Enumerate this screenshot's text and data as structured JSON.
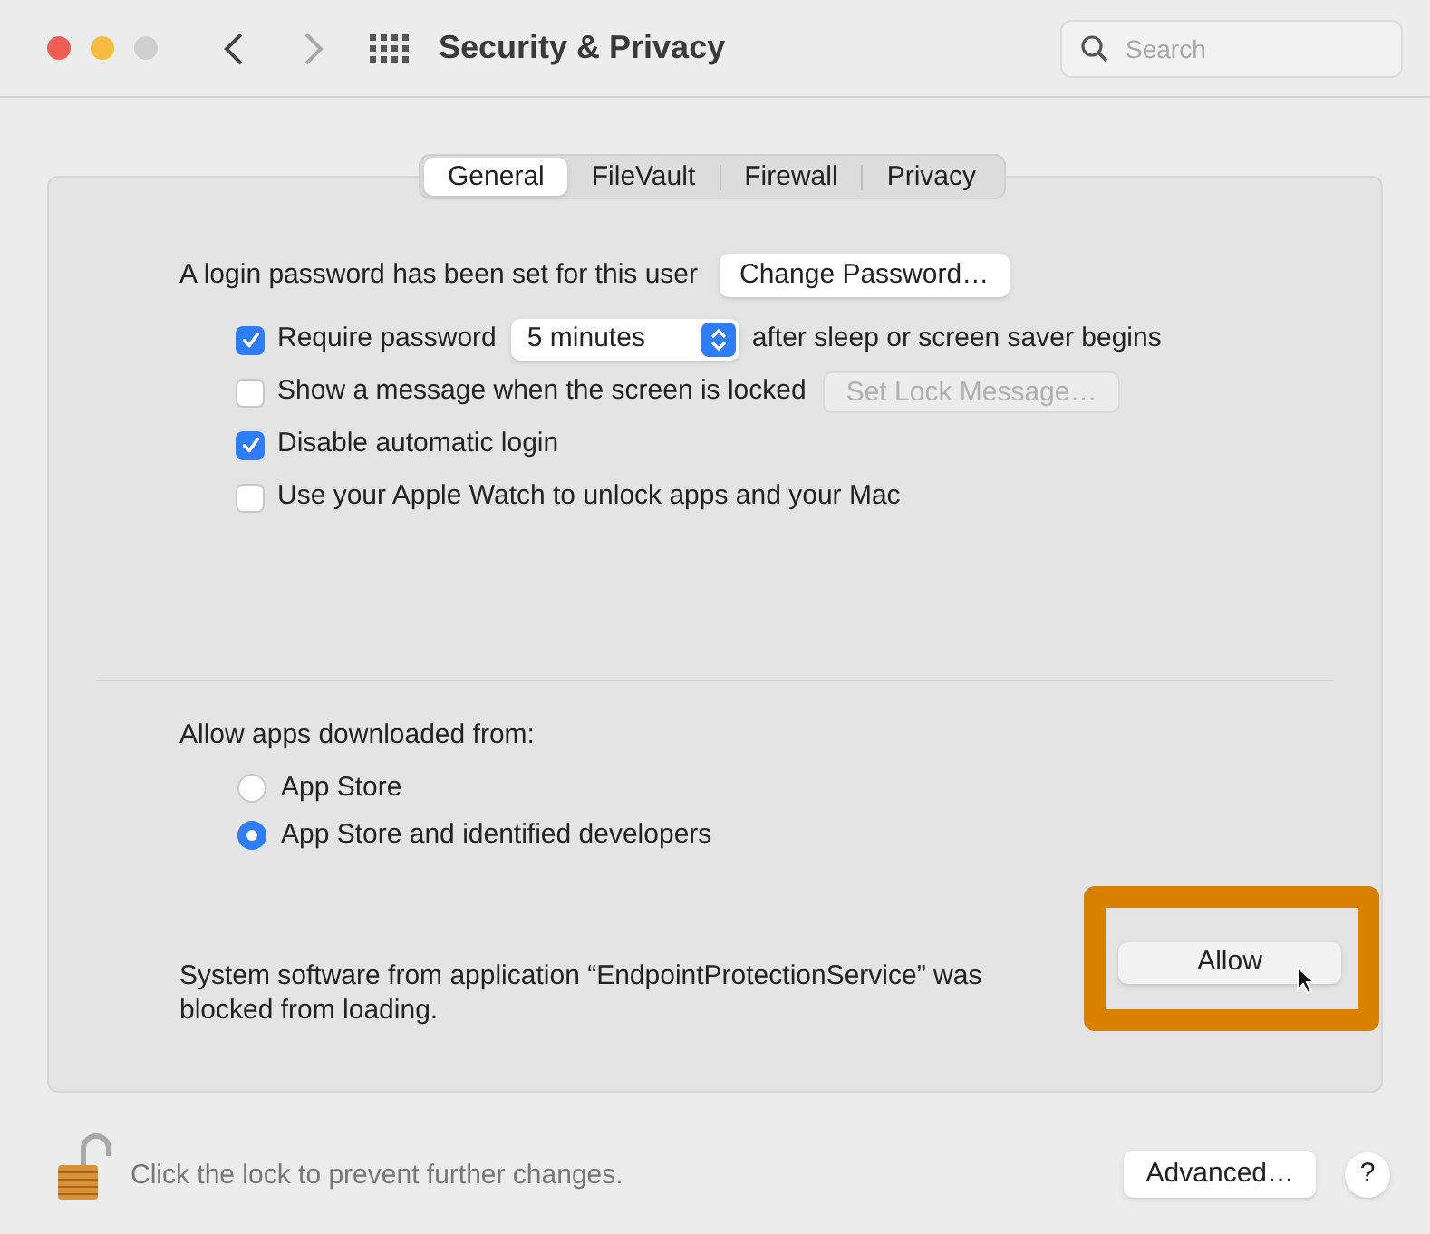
{
  "window": {
    "title": "Security & Privacy",
    "search": {
      "placeholder": "Search"
    }
  },
  "tabs": [
    {
      "label": "General",
      "selected": true
    },
    {
      "label": "FileVault",
      "selected": false
    },
    {
      "label": "Firewall",
      "selected": false
    },
    {
      "label": "Privacy",
      "selected": false
    }
  ],
  "login": {
    "text": "A login password has been set for this user",
    "button": "Change Password…"
  },
  "options": [
    {
      "kind": "select",
      "label": "Require password",
      "checked": true,
      "value": "5 minutes",
      "suffix": "after sleep or screen saver begins"
    },
    {
      "kind": "button",
      "label": "Show a message when the screen is locked",
      "checked": false,
      "button": "Set Lock Message…",
      "disabled": true
    },
    {
      "kind": "plain",
      "label": "Disable automatic login",
      "checked": true
    },
    {
      "kind": "plain",
      "label": "Use your Apple Watch to unlock apps and your Mac",
      "checked": false
    }
  ],
  "downloads": {
    "heading": "Allow apps downloaded from:",
    "choices": [
      {
        "label": "App Store",
        "selected": false
      },
      {
        "label": "App Store and identified developers",
        "selected": true
      }
    ]
  },
  "blocked": {
    "message": "System software from application “EndpointProtectionService” was blocked from loading.",
    "button": "Allow",
    "highlighted": true
  },
  "footer": {
    "lock_text": "Click the lock to prevent further changes.",
    "locked": false,
    "advanced": "Advanced…",
    "help": "?"
  }
}
